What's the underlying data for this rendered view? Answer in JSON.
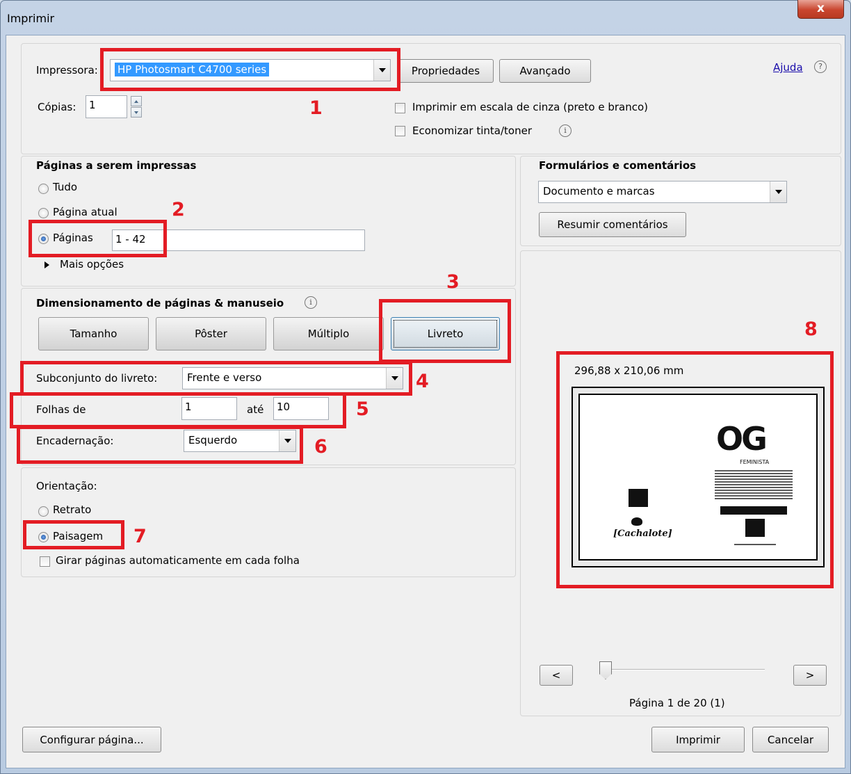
{
  "window": {
    "title": "Imprimir",
    "close_label": "x"
  },
  "printer": {
    "label": "Impressora:",
    "selected": "HP Photosmart C4700 series",
    "properties_button": "Propriedades",
    "advanced_button": "Avançado",
    "help_link": "Ajuda",
    "help_icon": "?"
  },
  "copies": {
    "label": "Cópias:",
    "value": "1"
  },
  "options": {
    "grayscale_label": "Imprimir em escala de cinza (preto e branco)",
    "save_ink_label": "Economizar tinta/toner"
  },
  "pages_section": {
    "heading": "Páginas a serem impressas",
    "all_label": "Tudo",
    "current_label": "Página atual",
    "pages_label": "Páginas",
    "pages_value": "1 - 42",
    "more_options_label": "Mais opções"
  },
  "sizing_section": {
    "heading": "Dimensionamento de páginas & manuseio",
    "buttons": [
      "Tamanho",
      "Pôster",
      "Múltiplo",
      "Livreto"
    ],
    "subset_label": "Subconjunto do livreto:",
    "subset_value": "Frente e verso",
    "sheets_label": "Folhas de",
    "sheets_from": "1",
    "sheets_to_label": "até",
    "sheets_to": "10",
    "binding_label": "Encadernação:",
    "binding_value": "Esquerdo"
  },
  "orientation": {
    "heading": "Orientação:",
    "portrait_label": "Retrato",
    "landscape_label": "Paisagem",
    "auto_rotate_label": "Girar páginas automaticamente em cada folha"
  },
  "forms": {
    "heading": "Formulários e comentários",
    "selected": "Documento e marcas",
    "summarize_button": "Resumir comentários"
  },
  "preview": {
    "dimensions": "296,88 x 210,06 mm",
    "prev_label": "<",
    "next_label": ">",
    "page_status": "Página 1 de 20 (1)",
    "slider_value": 0.0,
    "logo_og": "OG",
    "logo_feminista": "FEMINISTA",
    "logo_cachalote": "[Cachalote]"
  },
  "annotations": [
    "1",
    "2",
    "3",
    "4",
    "5",
    "6",
    "7",
    "8"
  ],
  "footer": {
    "page_setup_button": "Configurar página...",
    "print_button": "Imprimir",
    "cancel_button": "Cancelar"
  }
}
